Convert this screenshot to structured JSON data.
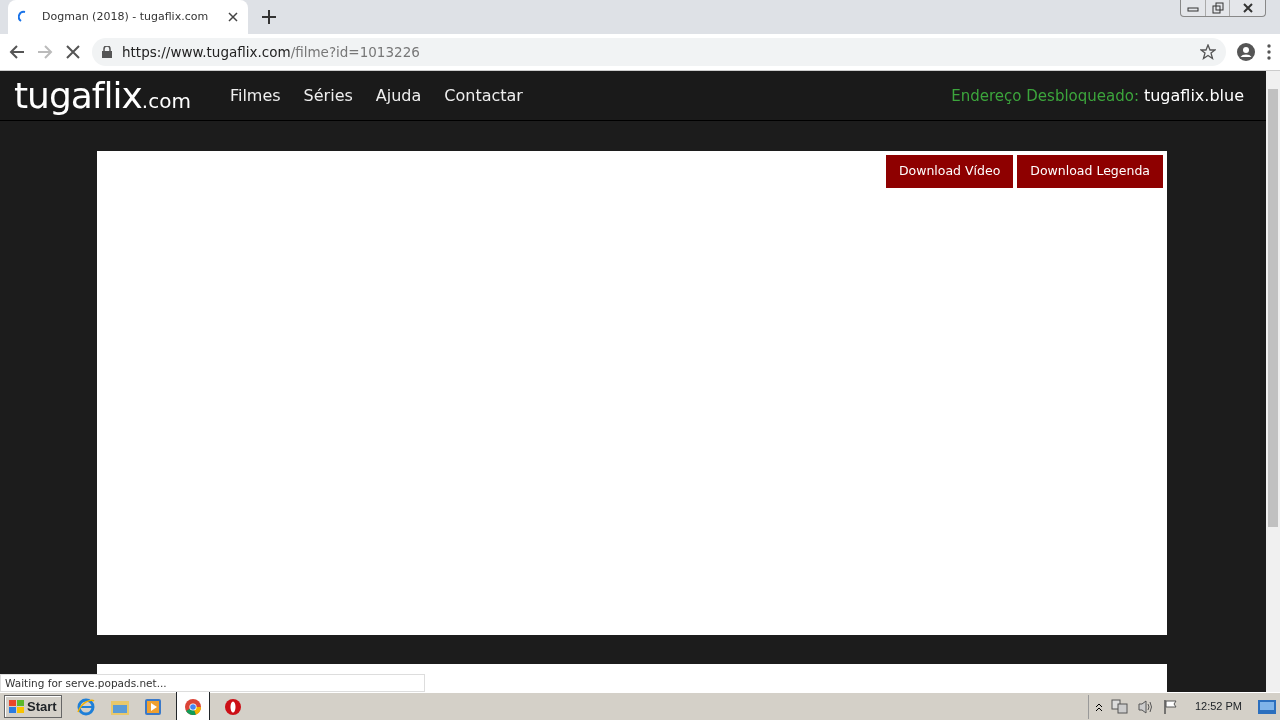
{
  "browser": {
    "tab": {
      "title": "Dogman (2018) - tugaflix.com",
      "loading": true
    },
    "address": {
      "host": "https://www.tugaflix.com",
      "path": "/filme?id=1013226"
    }
  },
  "site": {
    "logo": {
      "name": "tugaflix",
      "suffix": ".com"
    },
    "nav": [
      "Filmes",
      "Séries",
      "Ajuda",
      "Contactar"
    ],
    "notice": {
      "label": "Endereço Desbloqueado:",
      "value": "tugaflix.blue"
    },
    "buttons": [
      "Download Vídeo",
      "Download Legenda"
    ]
  },
  "status_bar": "Waiting for serve.popads.net...",
  "taskbar": {
    "start": "Start",
    "clock": "12:52 PM"
  }
}
